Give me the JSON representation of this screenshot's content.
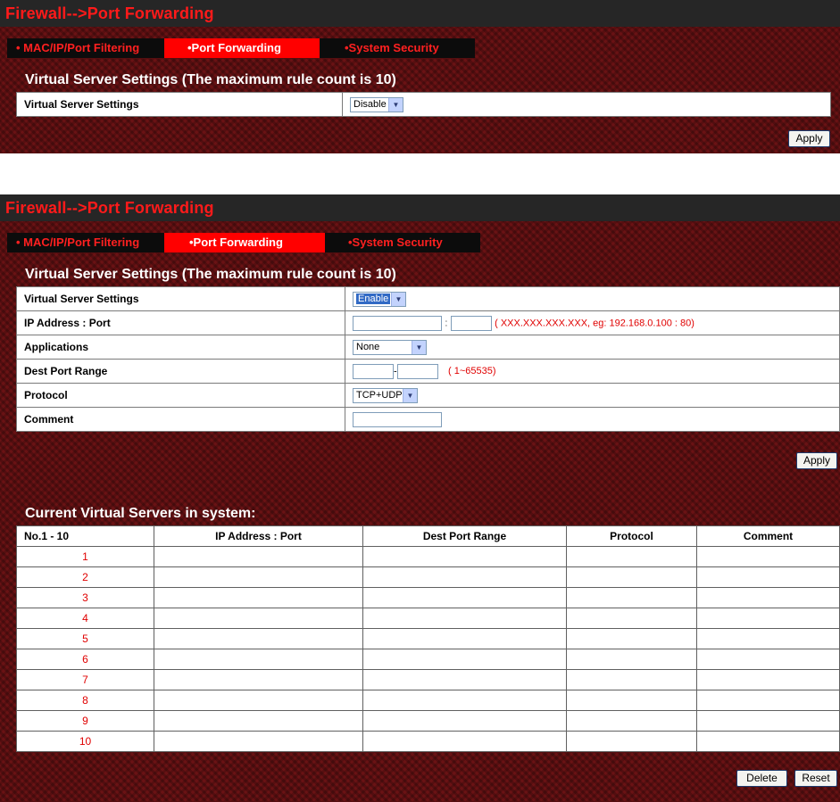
{
  "top": {
    "title": "Firewall-->Port Forwarding",
    "tabs": [
      {
        "label": "• MAC/IP/Port Filtering"
      },
      {
        "label": "•Port Forwarding"
      },
      {
        "label": "•System Security"
      }
    ],
    "section_title": "Virtual Server Settings (The maximum rule count is 10)",
    "setting_label": "Virtual Server Settings",
    "setting_value": "Disable",
    "apply_label": "Apply"
  },
  "bottom": {
    "title": "Firewall-->Port Forwarding",
    "tabs": [
      {
        "label": "• MAC/IP/Port Filtering"
      },
      {
        "label": "•Port Forwarding"
      },
      {
        "label": "•System Security"
      }
    ],
    "section_title": "Virtual Server Settings (The maximum rule count is 10)",
    "form": {
      "vs_label": "Virtual Server Settings",
      "vs_value": "Enable",
      "ip_label": "IP Address : Port",
      "ip_colon": ":",
      "ip_hint": "( XXX.XXX.XXX.XXX, eg: 192.168.0.100 : 80)",
      "app_label": "Applications",
      "app_value": "None",
      "range_label": "Dest Port Range",
      "range_dash": "-",
      "range_hint": "( 1~65535)",
      "proto_label": "Protocol",
      "proto_value": "TCP+UDP",
      "comment_label": "Comment"
    },
    "apply_label": "Apply",
    "current_title": "Current Virtual Servers in system:",
    "columns": [
      "No.1 - 10",
      "IP Address : Port",
      "Dest Port Range",
      "Protocol",
      "Comment"
    ],
    "rows": [
      {
        "no": "1"
      },
      {
        "no": "2"
      },
      {
        "no": "3"
      },
      {
        "no": "4"
      },
      {
        "no": "5"
      },
      {
        "no": "6"
      },
      {
        "no": "7"
      },
      {
        "no": "8"
      },
      {
        "no": "9"
      },
      {
        "no": "10"
      }
    ],
    "delete_label": "Delete",
    "reset_label": "Reset"
  }
}
